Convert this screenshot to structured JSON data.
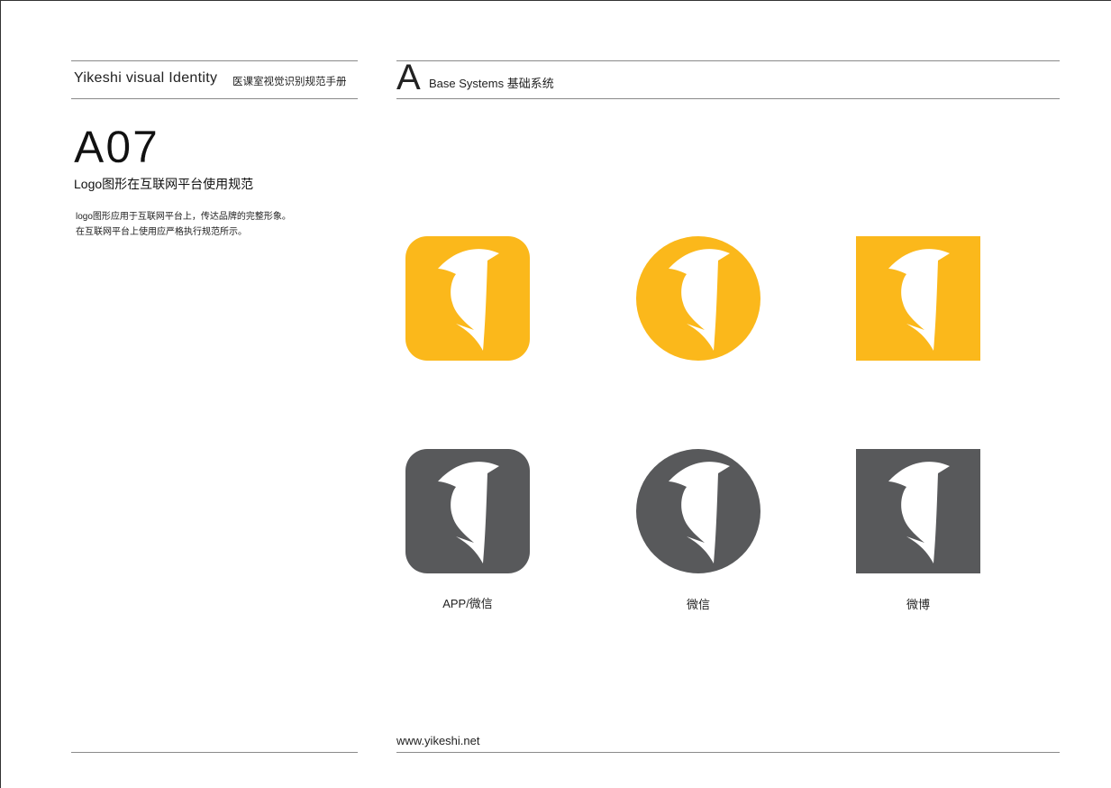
{
  "header": {
    "brand_en": "Yikeshi visual Identity",
    "brand_cn": "医课室视觉识别规范手册",
    "section_letter": "A",
    "section_title": "Base Systems 基础系统"
  },
  "page": {
    "code": "A07",
    "subtitle": "Logo图形在互联网平台使用规范",
    "description_lines": [
      "logo图形应用于互联网平台上，传达品牌的完整形象。",
      "在互联网平台上使用应严格执行规范所示。"
    ]
  },
  "colors": {
    "brand_yellow": "#FBB81B",
    "dark_gray": "#58595B",
    "bird": "#FFFFFF"
  },
  "icons": [
    {
      "row": "yellow",
      "shape": "rounded-square",
      "icon": "woodpecker-logo-icon"
    },
    {
      "row": "yellow",
      "shape": "circle",
      "icon": "woodpecker-logo-icon"
    },
    {
      "row": "yellow",
      "shape": "square",
      "icon": "woodpecker-logo-icon"
    },
    {
      "row": "gray",
      "shape": "rounded-square",
      "icon": "woodpecker-logo-icon"
    },
    {
      "row": "gray",
      "shape": "circle",
      "icon": "woodpecker-logo-icon"
    },
    {
      "row": "gray",
      "shape": "square",
      "icon": "woodpecker-logo-icon"
    }
  ],
  "captions": [
    "APP/微信",
    "微信",
    "微博"
  ],
  "footer": {
    "url": "www.yikeshi.net"
  }
}
